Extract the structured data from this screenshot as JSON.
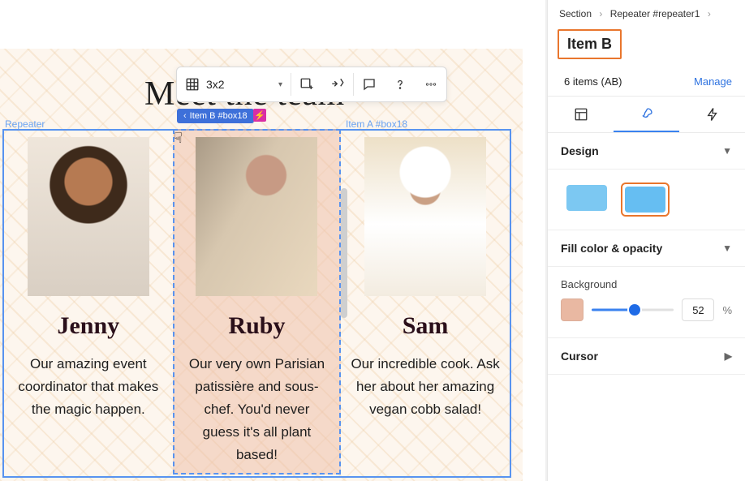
{
  "breadcrumb": {
    "a": "Section",
    "b": "Repeater #repeater1"
  },
  "panel": {
    "title": "Item B",
    "items_count_label": "6 items (AB)",
    "manage_label": "Manage",
    "design_label": "Design",
    "fill_label": "Fill color & opacity",
    "background_label": "Background",
    "opacity_value": "52",
    "opacity_unit": "%",
    "cursor_label": "Cursor"
  },
  "toolbar": {
    "grid_label": "3x2"
  },
  "canvas": {
    "heading": "Meet the team",
    "repeater_label": "Repeater",
    "item_b_label": "Item B #box18",
    "item_a_label": "Item A #box18"
  },
  "team": [
    {
      "name": "Jenny",
      "desc": "Our amazing event coordinator that makes the magic happen."
    },
    {
      "name": "Ruby",
      "desc": "Our very own Parisian patissière and sous-chef. You'd never guess it's all plant based!"
    },
    {
      "name": "Sam",
      "desc": "Our incredible cook. Ask her about her amazing vegan cobb salad!"
    }
  ]
}
